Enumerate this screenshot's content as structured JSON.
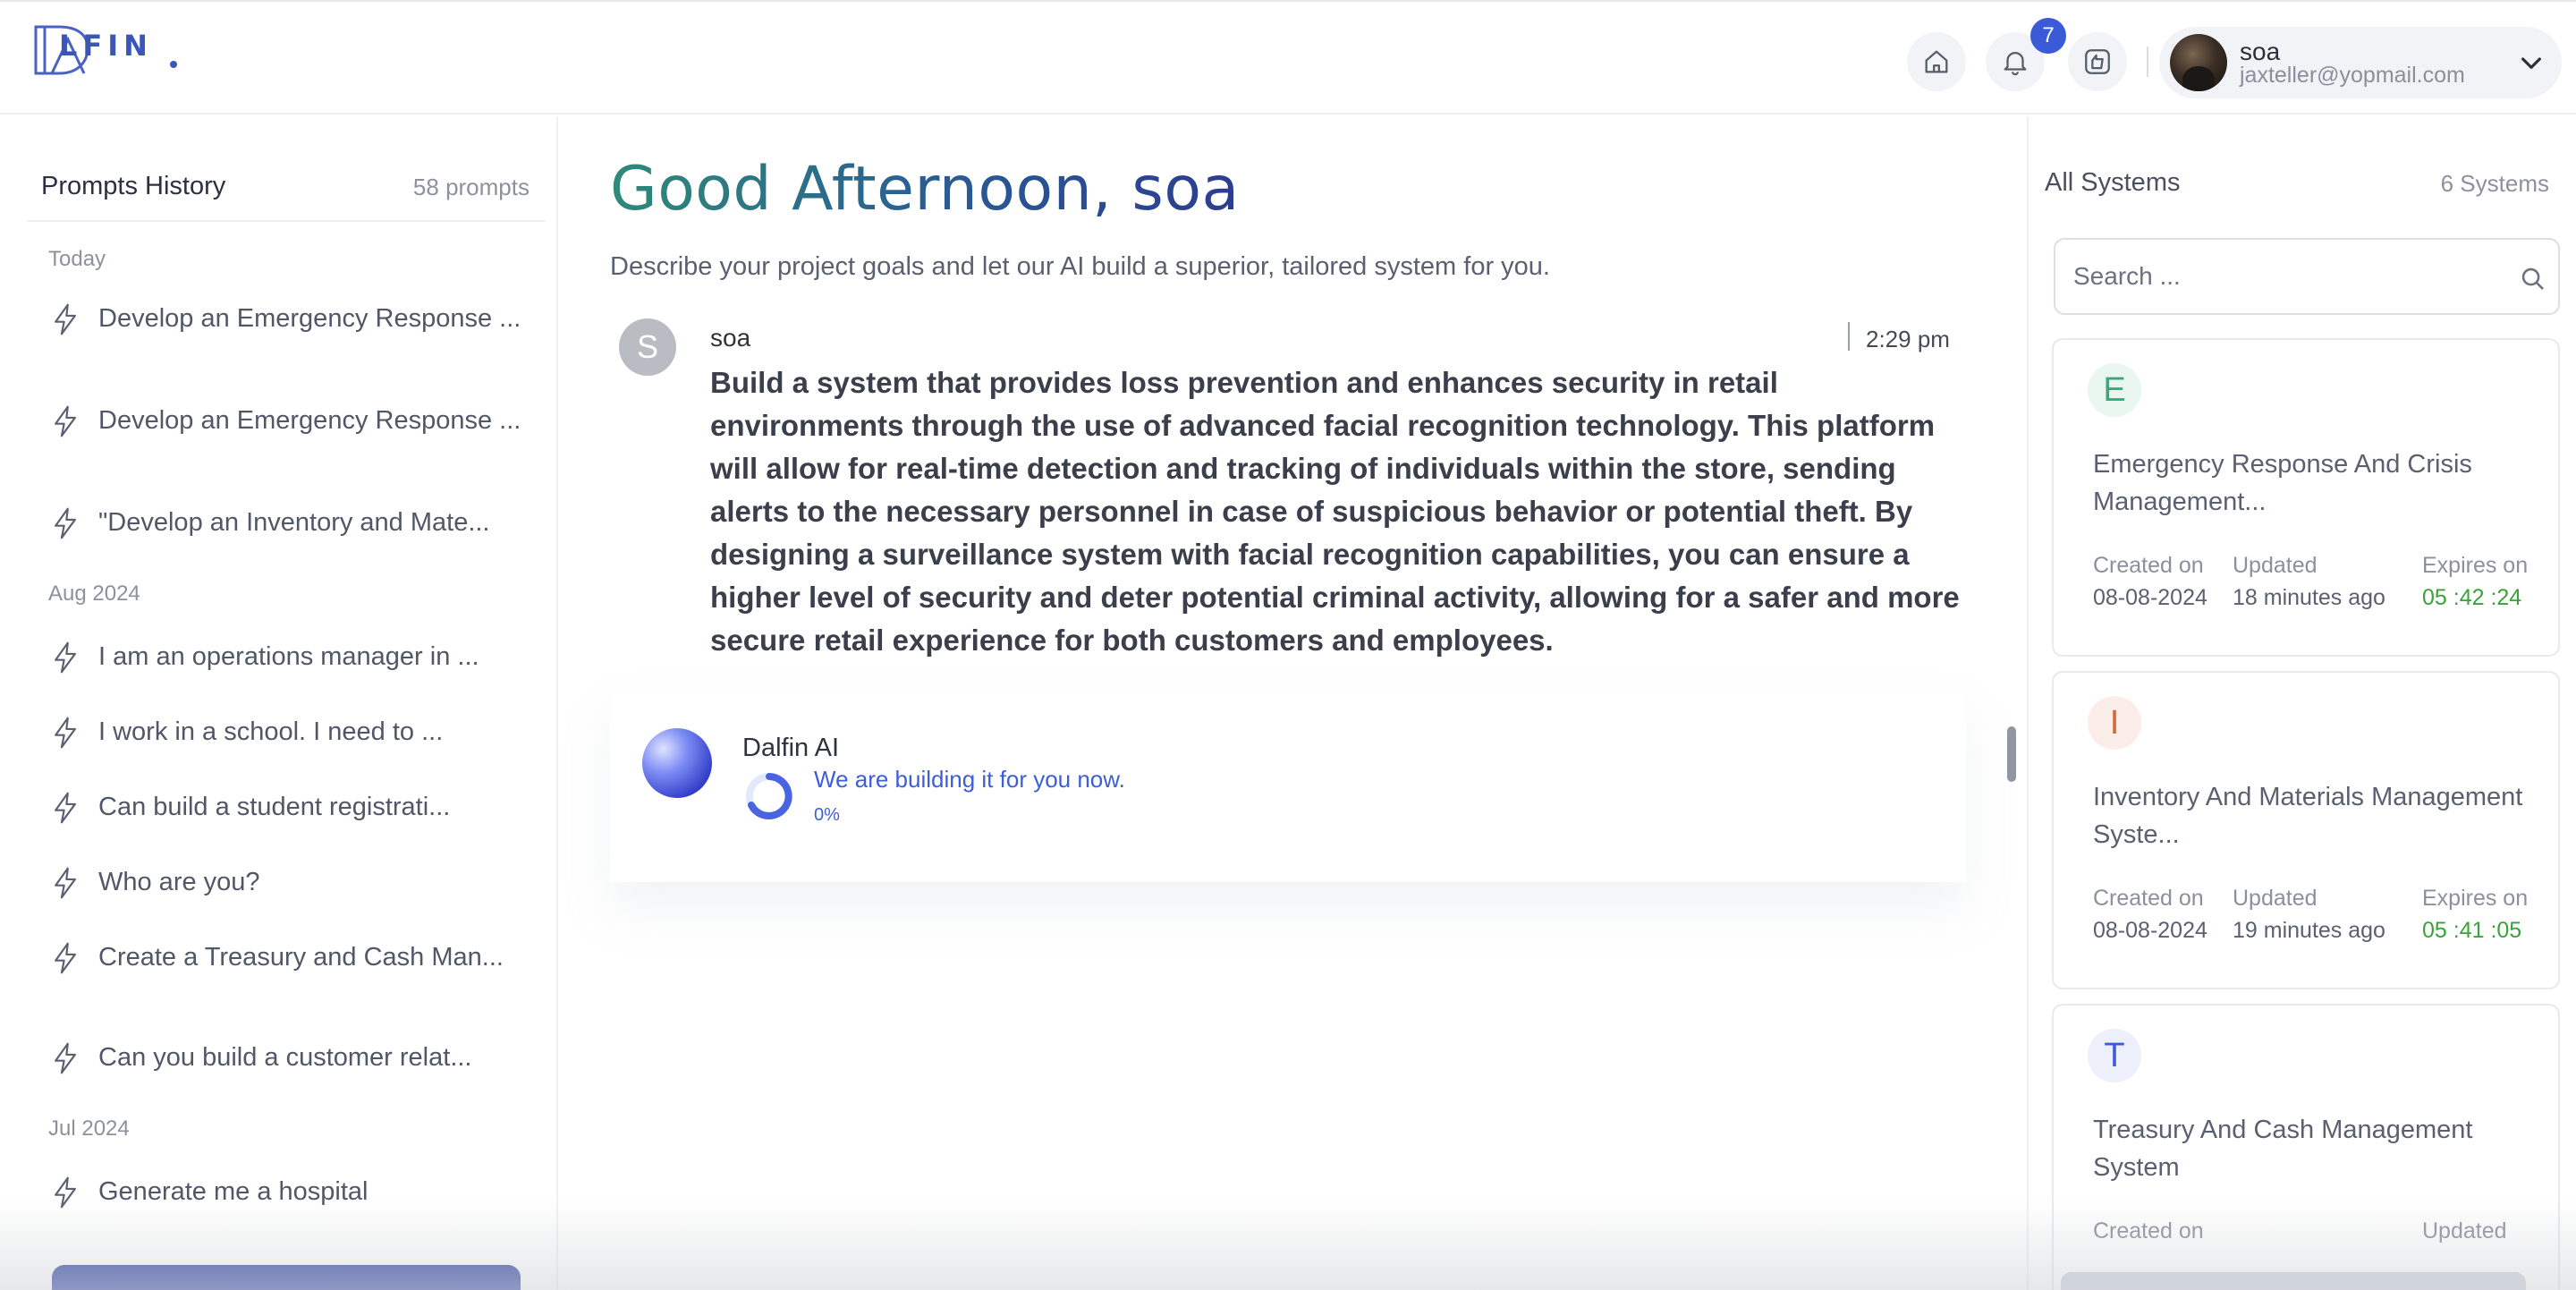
{
  "header": {
    "logo_text": "LFIN",
    "notification_count": "7",
    "user": {
      "name": "soa",
      "email": "jaxteller@yopmail.com"
    }
  },
  "sidebar": {
    "title": "Prompts History",
    "count": "58 prompts",
    "groups": [
      {
        "label": "Today"
      },
      {
        "label": "Aug 2024"
      },
      {
        "label": "Jul 2024"
      }
    ],
    "items": [
      {
        "label": "Develop an Emergency Response ..."
      },
      {
        "label": "Develop an Emergency Response ..."
      },
      {
        "label": "\"Develop an Inventory and Mate..."
      },
      {
        "label": "I am an operations manager in ..."
      },
      {
        "label": "I work in a school. I need to ..."
      },
      {
        "label": "Can build a student registrati..."
      },
      {
        "label": "Who are you?"
      },
      {
        "label": "Create a Treasury and Cash Man..."
      },
      {
        "label": "Can you build a customer relat..."
      },
      {
        "label": "Generate me a hospital"
      }
    ]
  },
  "main": {
    "greeting": "Good Afternoon, soa",
    "subtitle": "Describe your project goals and let our AI build a superior, tailored system for you.",
    "message": {
      "avatar_letter": "S",
      "author": "soa",
      "time": "2:29 pm",
      "text": "Build a system that provides loss prevention and enhances security in retail environments through the use of advanced facial recognition technology. This platform will allow for real-time detection and tracking of individuals within the store, sending alerts to the necessary personnel in case of suspicious behavior or potential theft. By designing a surveillance system with facial recognition capabilities, you can ensure a higher level of security and deter potential criminal activity, allowing for a safer and more secure retail experience for both customers and employees."
    },
    "ai": {
      "name": "Dalfin AI",
      "status": "We are building it for you now.",
      "progress": "0%"
    }
  },
  "systems": {
    "title": "All Systems",
    "count": "6 Systems",
    "search_placeholder": "Search ...",
    "labels": {
      "created": "Created on",
      "updated": "Updated",
      "expires": "Expires on"
    },
    "cards": [
      {
        "letter": "E",
        "title": "Emergency Response And Crisis Management...",
        "created": "08-08-2024",
        "updated": "18 minutes ago",
        "expires": "05 :42 :24",
        "accent": "#3aa878",
        "accent_bg": "#eaf7f1"
      },
      {
        "letter": "I",
        "title": "Inventory And Materials Management Syste...",
        "created": "08-08-2024",
        "updated": "19 minutes ago",
        "expires": "05 :41 :05",
        "accent": "#d9643a",
        "accent_bg": "#fbeee8"
      },
      {
        "letter": "T",
        "title": "Treasury And Cash Management System",
        "created": "Created on",
        "updated": "Updated",
        "expires": "",
        "accent": "#3a5ad8",
        "accent_bg": "#edf0fb"
      }
    ]
  },
  "colors": {
    "brand": "#3a57b8",
    "accent_blue": "#3d5ed6",
    "expire_green": "#3aa23a"
  }
}
